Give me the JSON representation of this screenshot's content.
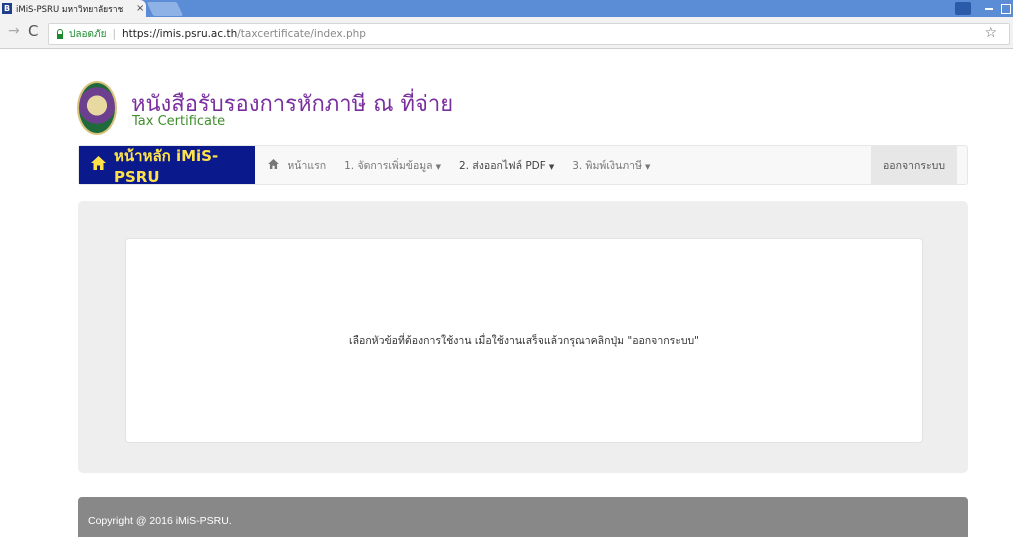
{
  "browser": {
    "tab_title": "iMiS-PSRU มหาวิทยาลัยราช",
    "tab_favicon": "B",
    "tab_close": "×",
    "secure_label": "ปลอดภัย",
    "url_host": "https://imis.psru.ac.th",
    "url_path": "/taxcertificate/index.php",
    "back_icon": "→",
    "reload_icon": "C",
    "star_icon": "☆"
  },
  "header": {
    "title_th": "หนังสือรับรองการหักภาษี ณ ที่จ่าย",
    "title_en": "Tax Certificate"
  },
  "navbar": {
    "brand_label": "หน้าหลัก iMiS-PSRU",
    "items": [
      {
        "label": "หน้าแรก",
        "icon": "home-icon"
      },
      {
        "label": "1. จัดการเพิ่มข้อมูล",
        "dropdown": true
      },
      {
        "label": "2. ส่งออกไฟล์ PDF",
        "dropdown": true
      },
      {
        "label": "3. พิมพ์เงินภาษี",
        "dropdown": true
      }
    ],
    "logout_label": "ออกจากระบบ"
  },
  "main": {
    "instruction": "เลือกหัวข้อที่ต้องการใช้งาน เมื่อใช้งานเสร็จแล้วกรุณาคลิกปุ่ม \"ออกจากระบบ\""
  },
  "footer": {
    "copyright": "Copyright @ 2016 iMiS-PSRU."
  },
  "colors": {
    "brand_bg": "#0a1a8c",
    "brand_text": "#ffe24a",
    "title_th": "#7a2f9e",
    "title_en": "#3e8e2c",
    "footer_bg": "#888888"
  }
}
